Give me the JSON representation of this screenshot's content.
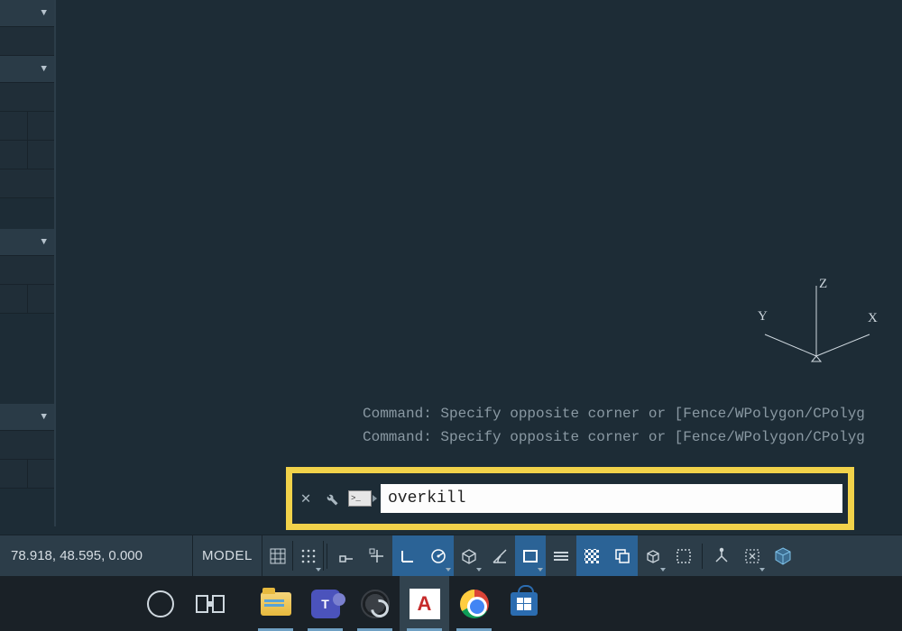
{
  "left_rail": {
    "dropdowns": 4
  },
  "ucs": {
    "labels": {
      "x": "X",
      "y": "Y",
      "z": "Z"
    }
  },
  "command_history": {
    "line1": "Command: Specify opposite corner or [Fence/WPolygon/CPolyg",
    "line2": "Command: Specify opposite corner or [Fence/WPolygon/CPolyg"
  },
  "command_line": {
    "value": "overkill",
    "badge_glyph": ">_"
  },
  "statusbar": {
    "coords": "78.918, 48.595, 0.000",
    "model": "MODEL",
    "icons": {
      "grid": "grid-icon",
      "dots": "grid-dots-icon",
      "snap": "snap-icon",
      "ortho_plus": "ortho-plus-icon",
      "perp": "perp-icon",
      "polar": "polar-icon",
      "iso": "isometric-icon",
      "angle": "angle-icon",
      "osnap": "osnap-rect-icon",
      "lines": "linetype-icon",
      "transparency": "transparency-icon",
      "sel_cycling": "selection-cycling-icon",
      "3dosnap": "3d-osnap-icon",
      "dynucs": "dynamic-ucs-icon",
      "filter": "filter-icon",
      "gizmo": "gizmo-icon",
      "viewcube": "viewcube-icon"
    }
  },
  "taskbar": {
    "cortana": "cortana-icon",
    "taskview": "task-view-icon",
    "explorer": "file-explorer-icon",
    "teams_letter": "T",
    "obs": "obs-icon",
    "autocad_letter": "A",
    "chrome": "chrome-icon",
    "store": "microsoft-store-icon"
  }
}
